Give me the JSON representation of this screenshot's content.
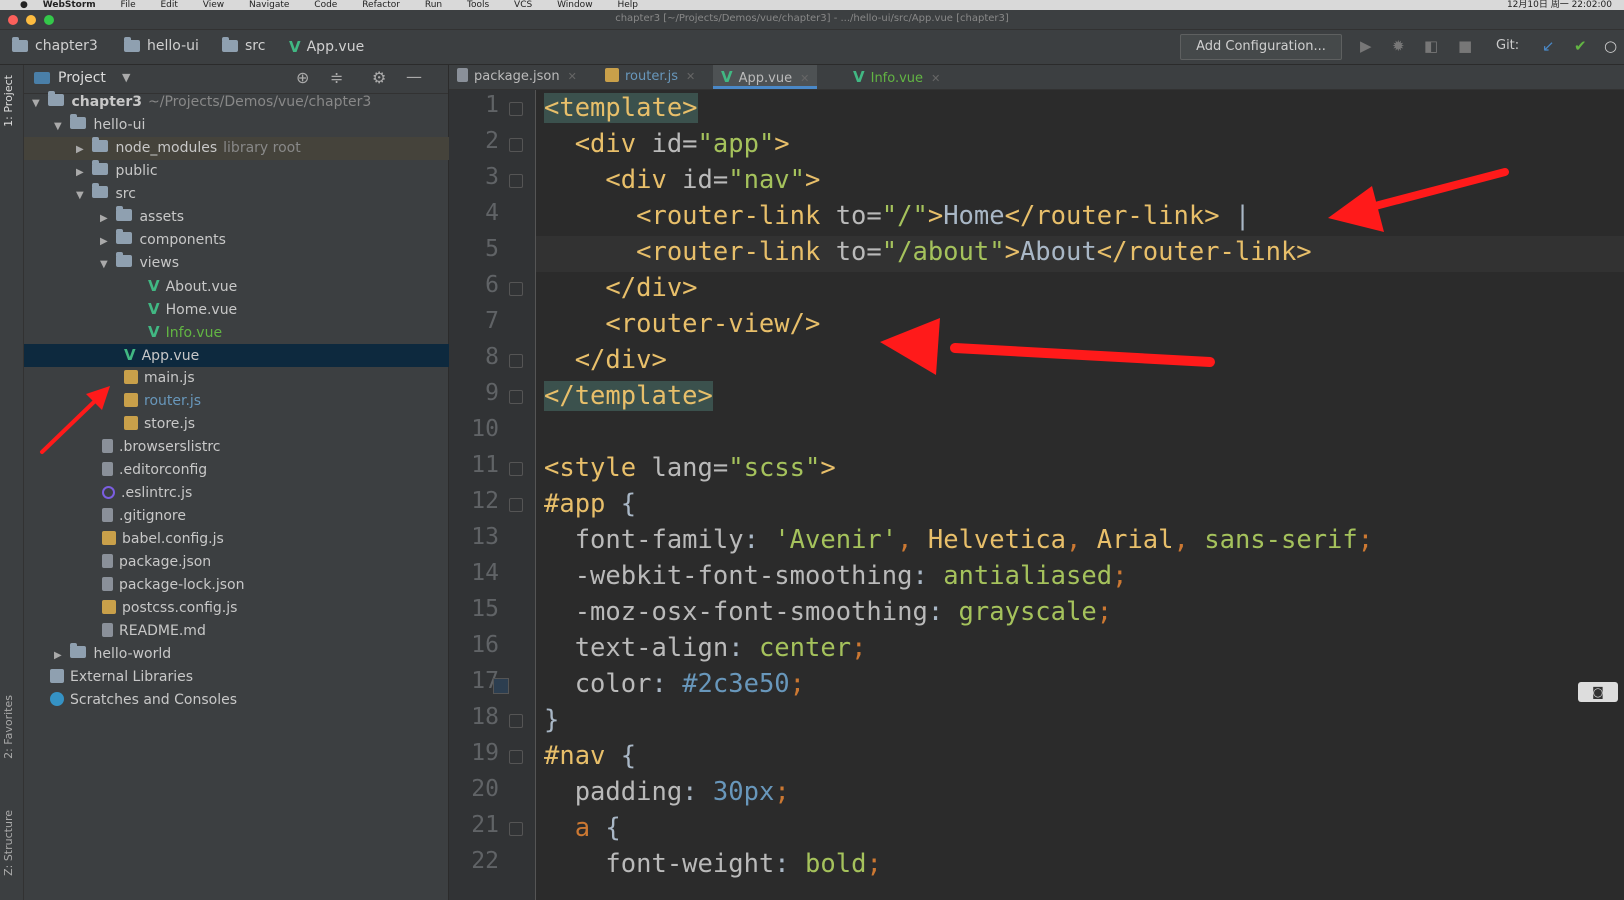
{
  "menubar": {
    "app": "WebStorm",
    "items": [
      "File",
      "Edit",
      "View",
      "Navigate",
      "Code",
      "Refactor",
      "Run",
      "Tools",
      "VCS",
      "Window",
      "Help"
    ],
    "clock": "12月10日 周一 22:02:00"
  },
  "window": {
    "title": "chapter3 [~/Projects/Demos/vue/chapter3] - .../hello-ui/src/App.vue [chapter3]"
  },
  "navbar": {
    "crumbs": [
      "chapter3",
      "hello-ui",
      "src",
      "App.vue"
    ],
    "add_config": "Add Configuration...",
    "git_label": "Git:"
  },
  "leftstrip": {
    "project": "1: Project",
    "favorites": "2: Favorites",
    "structure": "Z: Structure"
  },
  "project": {
    "header": "Project",
    "tree": [
      {
        "label": "chapter3",
        "extra": "~/Projects/Demos/vue/chapter3",
        "icon": "folder-icon",
        "arrow": "▼"
      },
      {
        "label": "hello-ui",
        "icon": "folder-icon",
        "arrow": "▼"
      },
      {
        "label": "node_modules",
        "extra": "library root",
        "icon": "folder-icon",
        "arrow": "▶"
      },
      {
        "label": "public",
        "icon": "folder-icon",
        "arrow": "▶"
      },
      {
        "label": "src",
        "icon": "folder-icon",
        "arrow": "▼"
      },
      {
        "label": "assets",
        "icon": "folder-icon",
        "arrow": "▶"
      },
      {
        "label": "components",
        "icon": "folder-icon",
        "arrow": "▶"
      },
      {
        "label": "views",
        "icon": "folder-icon",
        "arrow": "▼"
      },
      {
        "label": "About.vue",
        "icon": "vue-icon"
      },
      {
        "label": "Home.vue",
        "icon": "vue-icon"
      },
      {
        "label": "Info.vue",
        "icon": "vue-icon"
      },
      {
        "label": "App.vue",
        "icon": "vue-icon"
      },
      {
        "label": "main.js",
        "icon": "js-icon"
      },
      {
        "label": "router.js",
        "icon": "js-icon"
      },
      {
        "label": "store.js",
        "icon": "js-icon"
      },
      {
        "label": ".browserslistrc",
        "icon": "file-icon"
      },
      {
        "label": ".editorconfig",
        "icon": "file-icon"
      },
      {
        "label": ".eslintrc.js",
        "icon": "eslint-icon"
      },
      {
        "label": ".gitignore",
        "icon": "file-icon"
      },
      {
        "label": "babel.config.js",
        "icon": "js-icon"
      },
      {
        "label": "package.json",
        "icon": "json-icon"
      },
      {
        "label": "package-lock.json",
        "icon": "json-icon"
      },
      {
        "label": "postcss.config.js",
        "icon": "js-icon"
      },
      {
        "label": "README.md",
        "icon": "file-icon"
      },
      {
        "label": "hello-world",
        "icon": "folder-icon",
        "arrow": "▶"
      },
      {
        "label": "External Libraries",
        "icon": "library-icon"
      },
      {
        "label": "Scratches and Consoles",
        "icon": "scratch-icon"
      }
    ]
  },
  "tabs": [
    {
      "label": "package.json",
      "icon": "json-icon"
    },
    {
      "label": "router.js",
      "icon": "js-icon"
    },
    {
      "label": "App.vue",
      "icon": "vue-icon"
    },
    {
      "label": "Info.vue",
      "icon": "vue-icon"
    }
  ],
  "editor": {
    "line_numbers": [
      "1",
      "2",
      "3",
      "4",
      "5",
      "6",
      "7",
      "8",
      "9",
      "10",
      "11",
      "12",
      "13",
      "14",
      "15",
      "16",
      "17",
      "18",
      "19",
      "20",
      "21",
      "22"
    ],
    "code": {
      "l1": "<template>",
      "l2a": "  <div ",
      "l2b": "id=",
      "l2c": "\"app\"",
      "l2d": ">",
      "l3a": "    <div ",
      "l3b": "id=",
      "l3c": "\"nav\"",
      "l3d": ">",
      "l4a": "      <router-link ",
      "l4b": "to=",
      "l4c": "\"/\"",
      "l4d": ">",
      "l4e": "Home",
      "l4f": "</router-link>",
      "l4g": " |",
      "l5a": "      <router-link ",
      "l5b": "to=",
      "l5c": "\"/about\"",
      "l5d": ">",
      "l5e": "About",
      "l5f": "</router-link>",
      "l6": "    </div>",
      "l7": "    <router-view/>",
      "l8": "  </div>",
      "l9": "</template>",
      "l11a": "<style ",
      "l11b": "lang=",
      "l11c": "\"scss\"",
      "l11d": ">",
      "l12a": "#app",
      "l12b": " {",
      "l13a": "  font-family",
      "l13b": ": ",
      "l13c": "'Avenir'",
      "l13d": ", ",
      "l13e": "Helvetica",
      "l13f": ", ",
      "l13g": "Arial",
      "l13h": ", ",
      "l13i": "sans-serif",
      "l13j": ";",
      "l14a": "  -webkit-font-smoothing",
      "l14b": ": ",
      "l14c": "antialiased",
      "l14d": ";",
      "l15a": "  -moz-osx-font-smoothing",
      "l15b": ": ",
      "l15c": "grayscale",
      "l15d": ";",
      "l16a": "  text-align",
      "l16b": ": ",
      "l16c": "center",
      "l16d": ";",
      "l17a": "  color",
      "l17b": ": ",
      "l17c": "#2c3e50",
      "l17d": ";",
      "l18": "}",
      "l19a": "#nav",
      "l19b": " {",
      "l20a": "  padding",
      "l20b": ": ",
      "l20c": "30px",
      "l20d": ";",
      "l21a": "  a",
      "l21b": " {",
      "l22a": "    font-weight",
      "l22b": ": ",
      "l22c": "bold",
      "l22d": ";"
    }
  },
  "colors": {
    "accent": "#4a88c7",
    "annotation": "#ff1a1a",
    "vue_green": "#41b883"
  }
}
